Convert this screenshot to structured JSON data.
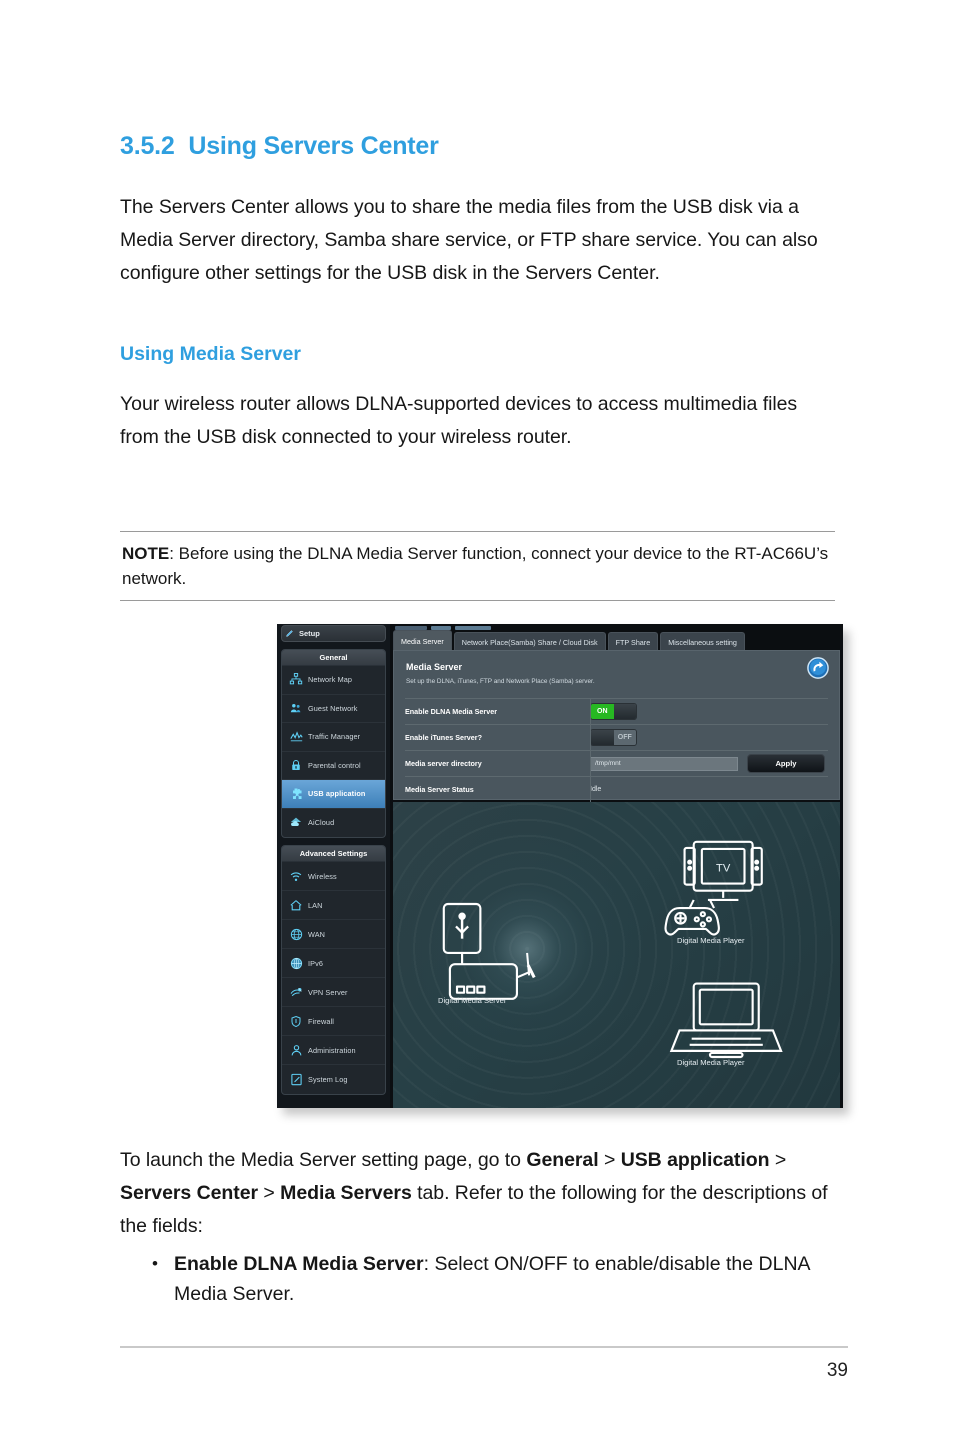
{
  "document": {
    "section_number": "3.5.2",
    "section_title": "Using Servers Center",
    "intro_paragraph": "The Servers Center allows you to share the media files from the USB disk via a Media Server directory, Samba share service, or FTP share service. You can also configure other settings for the USB disk in the Servers Center.",
    "subsection_title": "Using Media Server",
    "media_paragraph": "Your wireless router allows DLNA-supported devices to access multimedia files from the USB disk connected to your wireless router.",
    "note": {
      "label": "NOTE",
      "text": ":  Before using the DLNA Media Server function, connect your device to the RT-AC66U’s network."
    },
    "launch_paragraph": {
      "p1": "To launch the Media Server setting page, go to ",
      "b1": "General",
      "p2": " > ",
      "b2": "USB application",
      "p3": " > ",
      "b3": "Servers Center",
      "p4": " > ",
      "b4": "Media Servers",
      "p5": " tab. Refer to the following for the descriptions of the fields:"
    },
    "bullets": [
      {
        "marker": "•",
        "bold": "Enable DLNA Media Server",
        "rest": ": Select ON/OFF to enable/disable the DLNA Media Server."
      }
    ],
    "page_number": "39"
  },
  "screenshot": {
    "sidebar": {
      "setup_label": "Setup",
      "groups": [
        {
          "header": "General",
          "items": [
            {
              "label": "Network Map",
              "icon": "network-map-icon",
              "active": false
            },
            {
              "label": "Guest Network",
              "icon": "guest-network-icon",
              "active": false
            },
            {
              "label": "Traffic Manager",
              "icon": "traffic-manager-icon",
              "active": false
            },
            {
              "label": "Parental control",
              "icon": "parental-control-lock-icon",
              "active": false
            },
            {
              "label": "USB application",
              "icon": "usb-application-puzzle-icon",
              "active": true
            },
            {
              "label": "AiCloud",
              "icon": "aicloud-icon",
              "active": false
            }
          ]
        },
        {
          "header": "Advanced Settings",
          "items": [
            {
              "label": "Wireless",
              "icon": "wireless-wifi-icon",
              "active": false
            },
            {
              "label": "LAN",
              "icon": "lan-home-icon",
              "active": false
            },
            {
              "label": "WAN",
              "icon": "wan-globe-icon",
              "active": false
            },
            {
              "label": "IPv6",
              "icon": "ipv6-globe-icon",
              "active": false
            },
            {
              "label": "VPN Server",
              "icon": "vpn-server-icon",
              "active": false
            },
            {
              "label": "Firewall",
              "icon": "firewall-shield-icon",
              "active": false
            },
            {
              "label": "Administration",
              "icon": "administration-user-icon",
              "active": false
            },
            {
              "label": "System Log",
              "icon": "system-log-icon",
              "active": false
            }
          ]
        }
      ]
    },
    "tabs": [
      {
        "label": "Media Server",
        "active": true
      },
      {
        "label": "Network Place(Samba) Share / Cloud Disk",
        "active": false
      },
      {
        "label": "FTP Share",
        "active": false
      },
      {
        "label": "Miscellaneous setting",
        "active": false
      }
    ],
    "panel": {
      "title": "Media Server",
      "subtitle": "Set up the DLNA, iTunes, FTP and Network Place (Samba) server.",
      "back_icon": "back-arrow-icon",
      "rows": [
        {
          "label": "Enable DLNA Media Server",
          "control": "toggle",
          "state": "ON",
          "on_text": "ON",
          "off_text": "OFF"
        },
        {
          "label": "Enable iTunes Server?",
          "control": "toggle",
          "state": "OFF",
          "on_text": "ON",
          "off_text": "OFF"
        },
        {
          "label": "Media server directory",
          "control": "input",
          "value": "/tmp/mnt",
          "button": "Apply"
        },
        {
          "label": "Media Server Status",
          "control": "text",
          "value": "Idle"
        }
      ]
    },
    "diagram": {
      "server_label": "Digital  Media Server",
      "tv_label": "TV",
      "player_top_label": "Digital  Media Player",
      "player_bottom_label": "Digital  Media Player",
      "usb_icon": "usb-drive-icon",
      "router_icon": "router-icon",
      "tv_icon": "tv-icon",
      "gamepad_icon": "gamepad-icon",
      "laptop_icon": "laptop-icon"
    }
  },
  "colors": {
    "accent_blue": "#2f9fdf",
    "toggle_on_green": "#27b822",
    "panel_bg": "#4a565e",
    "sidebar_bg": "#12171c",
    "active_item": "#4a88bd"
  }
}
